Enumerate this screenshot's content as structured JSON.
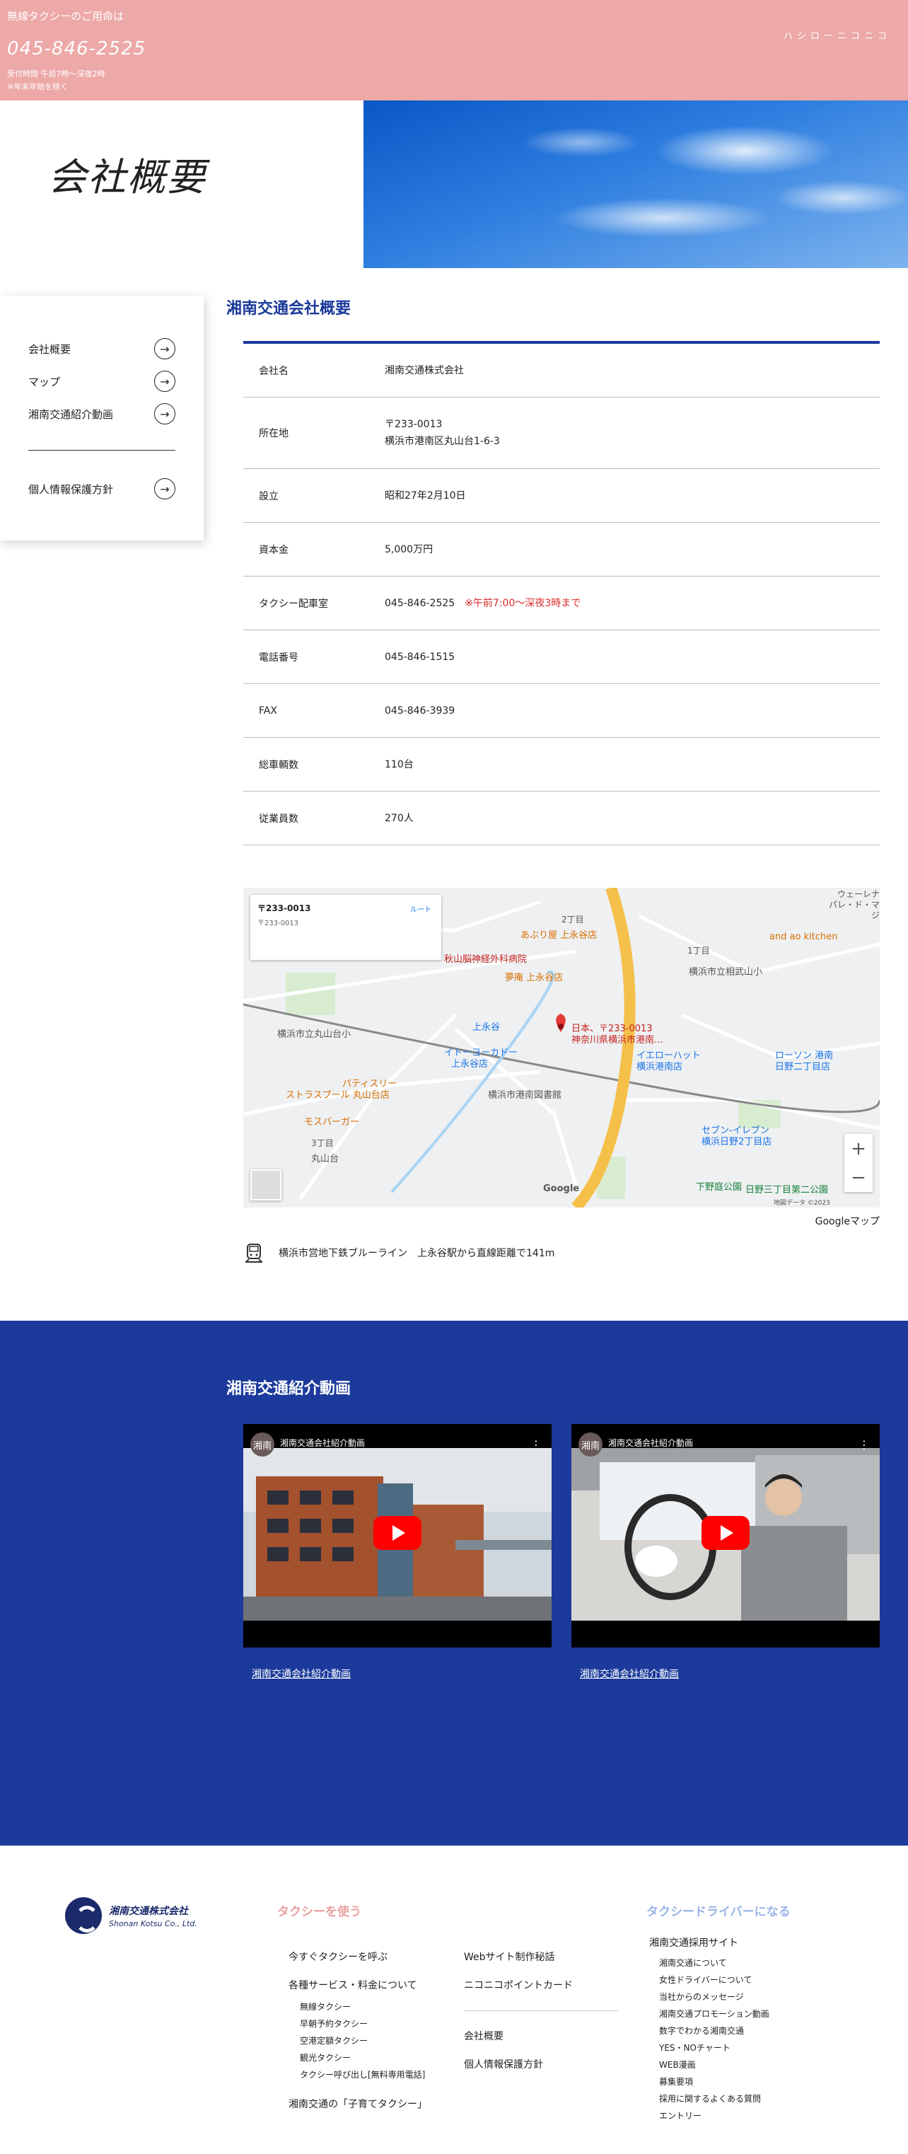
{
  "header": {
    "lead": "無線タクシーのご用命は",
    "phone": "045-846-2525",
    "hours": "受付時間 午前7時〜深夜2時",
    "note": "※年末年始を除く",
    "brand_kana": "ハシローニコニコ",
    "band_color": "#eda8a8"
  },
  "hero": {
    "title": "会社概要"
  },
  "side_nav": {
    "items": [
      {
        "label": "会社概要"
      },
      {
        "label": "マップ"
      },
      {
        "label": "湘南交通紹介動画"
      },
      {
        "label": "個人情報保護方針"
      }
    ],
    "arrow": "→"
  },
  "company": {
    "heading": "湘南交通会社概要",
    "rows": [
      {
        "key": "会社名",
        "value": "湘南交通株式会社"
      },
      {
        "key": "所在地",
        "value": "〒233-0013",
        "value2": "横浜市港南区丸山台1-6-3"
      },
      {
        "key": "設立",
        "value": "昭和27年2月10日"
      },
      {
        "key": "資本金",
        "value": "5,000万円"
      },
      {
        "key": "タクシー配車室",
        "value": "045-846-2525",
        "value_note": "※午前7:00〜深夜3時まで"
      },
      {
        "key": "電話番号",
        "value": "045-846-1515"
      },
      {
        "key": "FAX",
        "value": "045-846-3939"
      },
      {
        "key": "総車輌数",
        "value": "110台"
      },
      {
        "key": "従業員数",
        "value": "270人"
      }
    ],
    "accent": "#1a3a9a"
  },
  "map": {
    "card_title": "〒233-0013 ",
    "card_address": "〒233-0013 ",
    "card_link": "",
    "directions_label": "ルート",
    "pin_label_1": "日本、〒233-0013",
    "pin_label_2": "神奈川県横浜市港南…",
    "labels": {
      "clinic": "秋山脳神経外科病院",
      "abura": "あぶり屋 上永谷店",
      "yume": "夢庵 上永谷店",
      "ito": "イトーヨーカドー",
      "ito2": "上永谷店",
      "yellowhat": "イエローハット",
      "yellowhat2": "横浜港南店",
      "patisserie": "パティスリー",
      "patisserie2": "ストラスブール 丸山台店",
      "mos": "モスバーガー",
      "library": "横浜市港南図書館",
      "lawson": "ローソン 港南",
      "lawson2": "日野二丁目店",
      "seven": "セブン-イレブン",
      "seven2": "横浜日野2丁目店",
      "kamnagaya": "上永谷",
      "maruyamadai": "丸山台",
      "school": "横浜市立丸山台小",
      "sochiyama": "横浜市立相武山小",
      "kitchen": "and ao kitchen",
      "park": "下野庭公園",
      "hino3": "日野三丁目第二公園",
      "wellner": "ウェーレナ",
      "palais": "パレ・ド・マジ",
      "chome1": "1丁目",
      "chome2": "2丁目",
      "chome3": "3丁目",
      "google": "Google",
      "copyright": "地図データ ©2023"
    },
    "zoom_in": "+",
    "zoom_out": "−",
    "caption": "Googleマップ",
    "train_note": "横浜市営地下鉄ブルーライン　上永谷駅から直線距離で141m"
  },
  "videos": {
    "heading": "湘南交通紹介動画",
    "items": [
      {
        "channel": "湘南",
        "title": "湘南交通会社紹介動画",
        "link": "湘南交通会社紹介動画"
      },
      {
        "channel": "湘南",
        "title": "湘南交通会社紹介動画",
        "link": "湘南交通会社紹介動画"
      }
    ],
    "menu_icon": "⋮",
    "band_color": "#1b3a9b"
  },
  "footer": {
    "company_jp": "湘南交通株式会社",
    "company_en": "Shonan Kotsu Co., Ltd.",
    "col1": {
      "heading": "タクシーを使う",
      "heading_color": "#e8a0a0",
      "items": [
        "今すぐタクシーを呼ぶ",
        "各種サービス・料金について"
      ],
      "subitems": [
        "無線タクシー",
        "早朝予約タクシー",
        "空港定額タクシー",
        "観光タクシー",
        "タクシー呼び出し[無料専用電話]"
      ],
      "last": "湘南交通の「子育てタクシー」"
    },
    "col2": {
      "items": [
        "Webサイト制作秘話",
        "ニコニコポイントカード"
      ],
      "items2": [
        "会社概要",
        "個人情報保護方針"
      ]
    },
    "col3": {
      "heading": "タクシードライバーになる",
      "heading_color": "#9ab4e8",
      "title": "湘南交通採用サイト",
      "subitems": [
        "湘南交通について",
        "女性ドライバーについて",
        "当社からのメッセージ",
        "湘南交通プロモーション動画",
        "数字でわかる湘南交通",
        "YES・NOチャート",
        "WEB漫画",
        "募集要項",
        "採用に関するよくある質問",
        "エントリー"
      ]
    }
  }
}
